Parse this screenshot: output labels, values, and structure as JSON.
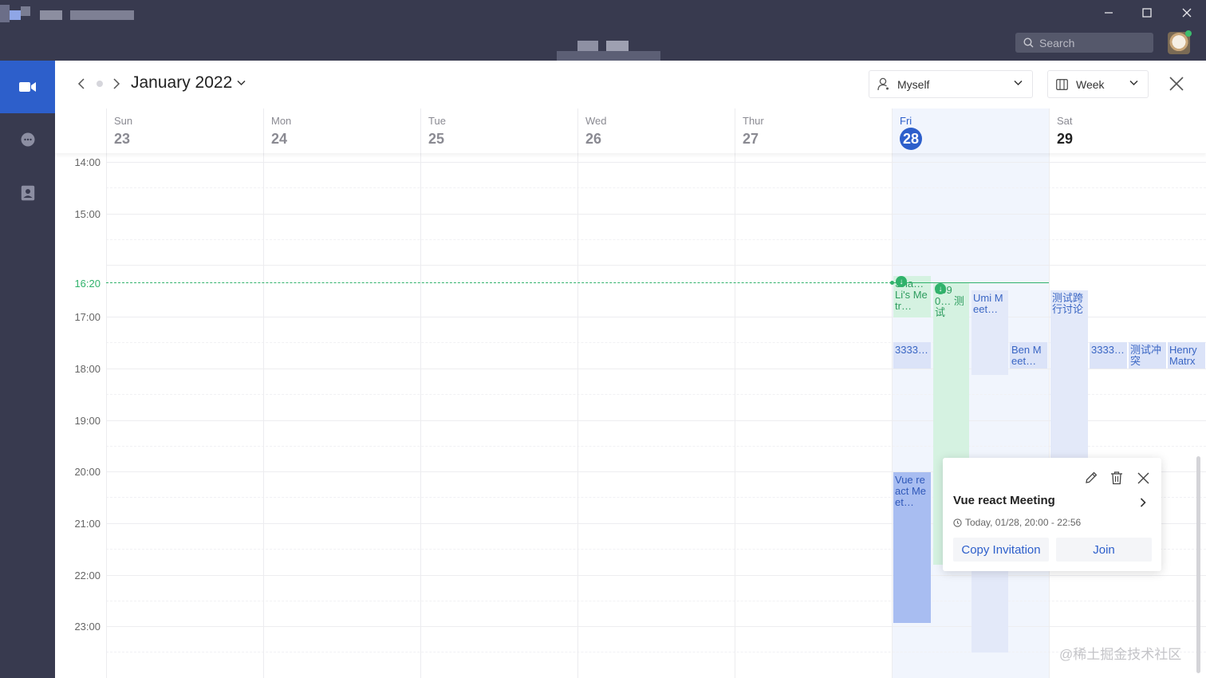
{
  "titlebar": {
    "search_placeholder": "Search",
    "window_controls": [
      "minimize-icon",
      "maximize-icon",
      "close-icon"
    ]
  },
  "rail": {
    "items": [
      {
        "name": "meetings",
        "icon": "video-camera-icon",
        "active": true
      },
      {
        "name": "chat",
        "icon": "chat-bubble-icon",
        "active": false
      },
      {
        "name": "contacts",
        "icon": "contact-card-icon",
        "active": false
      }
    ]
  },
  "toolbar": {
    "month_title": "January 2022",
    "owner_select": "Myself",
    "view_select": "Week"
  },
  "days": [
    {
      "name": "Sun",
      "num": "23"
    },
    {
      "name": "Mon",
      "num": "24"
    },
    {
      "name": "Tue",
      "num": "25"
    },
    {
      "name": "Wed",
      "num": "26"
    },
    {
      "name": "Thur",
      "num": "27"
    },
    {
      "name": "Fri",
      "num": "28",
      "today": true
    },
    {
      "name": "Sat",
      "num": "29"
    }
  ],
  "times": [
    "14:00",
    "15:00",
    "16:20",
    "17:00",
    "18:00",
    "19:00",
    "20:00",
    "21:00",
    "22:00",
    "23:00"
  ],
  "current_time": "16:20",
  "events": [
    {
      "label": "Sha… Li's Metr…",
      "day": "Fri",
      "color": "green"
    },
    {
      "label": "0090… 测试",
      "day": "Fri",
      "color": "green"
    },
    {
      "label": "Umi Meet…",
      "day": "Fri",
      "color": "lightblue"
    },
    {
      "label": "3333…",
      "day": "Fri",
      "color": "blue"
    },
    {
      "label": "Ben Meet…",
      "day": "Fri",
      "color": "blue"
    },
    {
      "label": "Vue react Meet…",
      "day": "Fri",
      "color": "blue-strong"
    },
    {
      "label": "测试跨行讨论",
      "day": "Sat",
      "color": "lightblue"
    },
    {
      "label": "3333…",
      "day": "Sat",
      "color": "blue"
    },
    {
      "label": "测试冲突",
      "day": "Sat",
      "color": "blue"
    },
    {
      "label": "Henry Matrx",
      "day": "Sat",
      "color": "blue"
    }
  ],
  "popover": {
    "title": "Vue react Meeting",
    "time": "Today, 01/28, 20:00 - 22:56",
    "copy_label": "Copy Invitation",
    "join_label": "Join"
  },
  "watermark": "@稀土掘金技术社区",
  "colors": {
    "chrome": "#383a4f",
    "accent": "#2d5fcb",
    "now": "#30b26b"
  }
}
